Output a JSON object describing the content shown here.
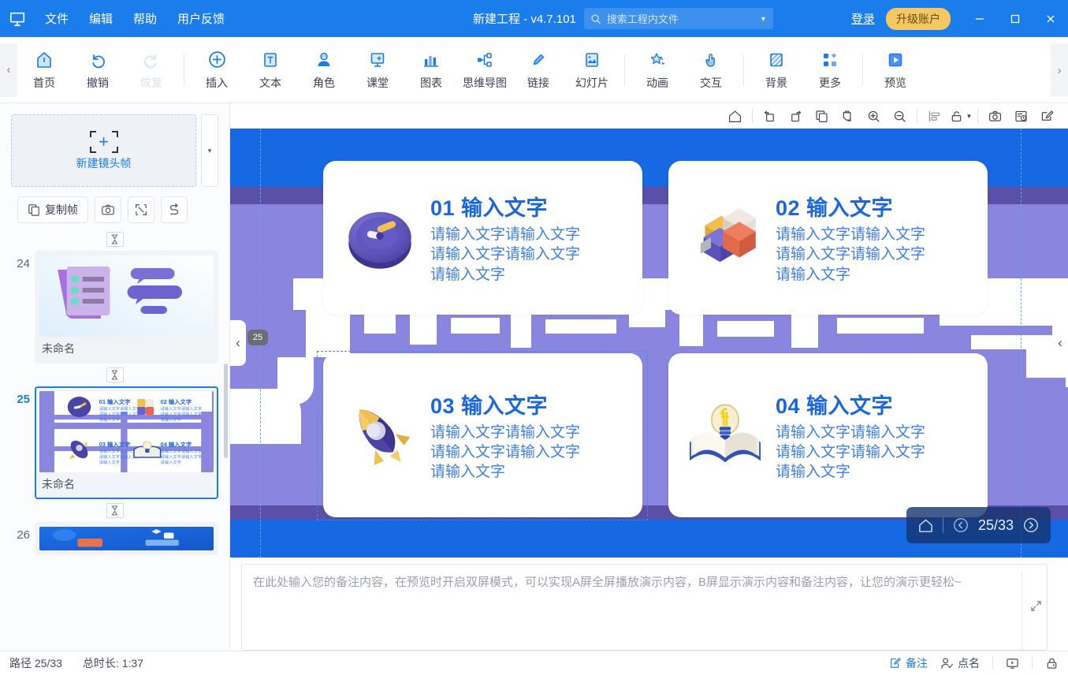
{
  "titlebar": {
    "logo_icon": "app-logo-icon",
    "menus": [
      "文件",
      "编辑",
      "帮助",
      "用户反馈"
    ],
    "project_title": "新建工程 - v4.7.101",
    "search_placeholder": "搜索工程内文件",
    "login_label": "登录",
    "upgrade_label": "升级账户",
    "minimize": "—",
    "maximize": "□",
    "close": "✕",
    "bg_color": "#1b7ceb",
    "upgrade_color": "#f5c763"
  },
  "ribbon": {
    "scroll_left": "‹",
    "scroll_right": "›",
    "groups": [
      {
        "items": [
          {
            "label": "首页",
            "icon": "home-icon",
            "disabled": false
          },
          {
            "label": "撤销",
            "icon": "undo-icon",
            "disabled": false
          },
          {
            "label": "恢复",
            "icon": "redo-icon",
            "disabled": true
          }
        ]
      },
      {
        "items": [
          {
            "label": "插入",
            "icon": "plus-circle-icon",
            "disabled": false
          },
          {
            "label": "文本",
            "icon": "text-box-icon",
            "disabled": false
          },
          {
            "label": "角色",
            "icon": "character-icon",
            "disabled": false
          },
          {
            "label": "课堂",
            "icon": "classroom-icon",
            "disabled": false
          },
          {
            "label": "图表",
            "icon": "chart-icon",
            "disabled": false
          },
          {
            "label": "思维导图",
            "icon": "mindmap-icon",
            "disabled": false
          },
          {
            "label": "链接",
            "icon": "link-icon",
            "disabled": false
          },
          {
            "label": "幻灯片",
            "icon": "slide-icon",
            "disabled": false
          }
        ]
      },
      {
        "items": [
          {
            "label": "动画",
            "icon": "animation-star-icon",
            "disabled": false
          },
          {
            "label": "交互",
            "icon": "interaction-hand-icon",
            "disabled": false
          }
        ]
      },
      {
        "items": [
          {
            "label": "背景",
            "icon": "background-icon",
            "disabled": false
          },
          {
            "label": "更多",
            "icon": "more-grid-icon",
            "disabled": false
          }
        ]
      },
      {
        "items": [
          {
            "label": "预览",
            "icon": "preview-play-icon",
            "disabled": false
          }
        ]
      }
    ]
  },
  "left_panel": {
    "new_frame_label": "新建镜头帧",
    "new_frame_dropdown": "▾",
    "tools": [
      {
        "label": "复制帧",
        "icon": "copy-frame-icon",
        "wide": true
      },
      {
        "label": "",
        "icon": "camera-icon",
        "wide": false
      },
      {
        "label": "",
        "icon": "fit-frame-icon",
        "wide": false
      },
      {
        "label": "",
        "icon": "path-order-icon",
        "wide": false
      }
    ],
    "slides": [
      {
        "number": "24",
        "name": "未命名",
        "active": false,
        "theme": "checklist"
      },
      {
        "number": "25",
        "name": "未命名",
        "active": true,
        "theme": "fourcards"
      },
      {
        "number": "26",
        "name": "",
        "active": false,
        "theme": "blue"
      }
    ]
  },
  "canvas_toolbar": {
    "buttons": [
      {
        "icon": "home-outline-icon",
        "name": "canvas-home"
      },
      {
        "icon": "rotate-left-icon",
        "name": "rotate-left"
      },
      {
        "icon": "rotate-right-icon",
        "name": "rotate-right"
      },
      {
        "icon": "copy-icon",
        "name": "copy"
      },
      {
        "icon": "paste-icon",
        "name": "paste"
      },
      {
        "icon": "zoom-in-icon",
        "name": "zoom-in"
      },
      {
        "icon": "zoom-out-icon",
        "name": "zoom-out"
      },
      {
        "icon": "align-icon",
        "name": "align"
      },
      {
        "icon": "unlock-icon",
        "name": "lock-toggle",
        "caret": "▾"
      },
      {
        "icon": "snapshot-icon",
        "name": "snapshot"
      },
      {
        "icon": "timeline-icon",
        "name": "timeline"
      },
      {
        "icon": "edit-icon",
        "name": "edit"
      }
    ]
  },
  "canvas": {
    "bg_color": "#1668e3",
    "accent_purple": "#8a86e0",
    "accent_dark_purple": "#5b4fa8",
    "frame_badge": "25",
    "cards": [
      {
        "title": "01 输入文字",
        "icon": "clock-3d-icon",
        "lines": [
          "请输入文字请输入文字",
          "请输入文字请输入文字",
          "请输入文字"
        ]
      },
      {
        "title": "02 输入文字",
        "icon": "cube-blocks-3d-icon",
        "lines": [
          "请输入文字请输入文字",
          "请输入文字请输入文字",
          "请输入文字"
        ]
      },
      {
        "title": "03 输入文字",
        "icon": "rocket-3d-icon",
        "lines": [
          "请输入文字请输入文字",
          "请输入文字请输入文字",
          "请输入文字"
        ]
      },
      {
        "title": "04 输入文字",
        "icon": "book-bulb-3d-icon",
        "lines": [
          "请输入文字请输入文字",
          "请输入文字请输入文字",
          "请输入文字"
        ]
      }
    ],
    "nav": {
      "home_icon": "home-outline-icon",
      "prev_icon": "chevron-left-circle-icon",
      "counter": "25/33",
      "next_icon": "chevron-right-circle-icon"
    },
    "left_arrow": "‹",
    "right_arrow": "‹"
  },
  "notes": {
    "placeholder": "在此处输入您的备注内容，在预览时开启双屏模式，可以实现A屏全屏播放演示内容，B屏显示演示内容和备注内容，让您的演示更轻松~",
    "resize_icon": "resize-diagonal-icon"
  },
  "statusbar": {
    "path_label": "路径 25/33",
    "duration_label": "总时长: 1:37",
    "items": [
      {
        "label": "备注",
        "icon": "note-edit-icon",
        "active": true
      },
      {
        "label": "点名",
        "icon": "roll-call-icon",
        "active": false
      },
      {
        "label": "",
        "icon": "present-screen-icon",
        "active": false
      },
      {
        "label": "",
        "icon": "lock-icon",
        "active": false
      }
    ]
  }
}
